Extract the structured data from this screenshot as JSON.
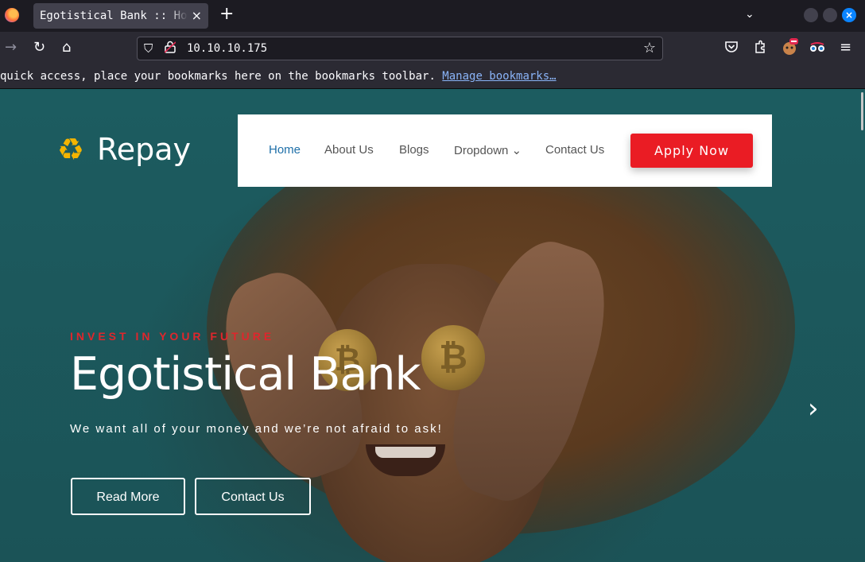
{
  "browser": {
    "tab_title": "Egotistical Bank :: Home",
    "tab_close": "×",
    "new_tab": "+",
    "tab_list": "⌄",
    "window_close": "×",
    "url": "10.10.10.175",
    "bookmarks_message": "quick access, place your bookmarks here on the bookmarks toolbar. ",
    "bookmarks_link": "Manage bookmarks…",
    "icons": {
      "back": "→",
      "reload": "↻",
      "home": "⌂",
      "shield": "⛉",
      "lock": "🔓",
      "star": "☆",
      "pocket": "◡",
      "extensions": "✦",
      "menu": "≡"
    }
  },
  "site": {
    "logo_icon": "♻",
    "logo_text": "Repay",
    "nav": [
      {
        "label": "Home"
      },
      {
        "label": "About Us"
      },
      {
        "label": "Blogs"
      },
      {
        "label": "Dropdown ⌄"
      },
      {
        "label": "Contact Us"
      }
    ],
    "apply_button": "Apply Now",
    "hero": {
      "eyebrow": "INVEST IN YOUR FUTURE",
      "title": "Egotistical Bank",
      "subtitle": "We want all of your money and we’re not afraid to ask!",
      "read_more": "Read More",
      "contact_us": "Contact Us",
      "next": "›"
    },
    "coin_symbol": "₿"
  }
}
